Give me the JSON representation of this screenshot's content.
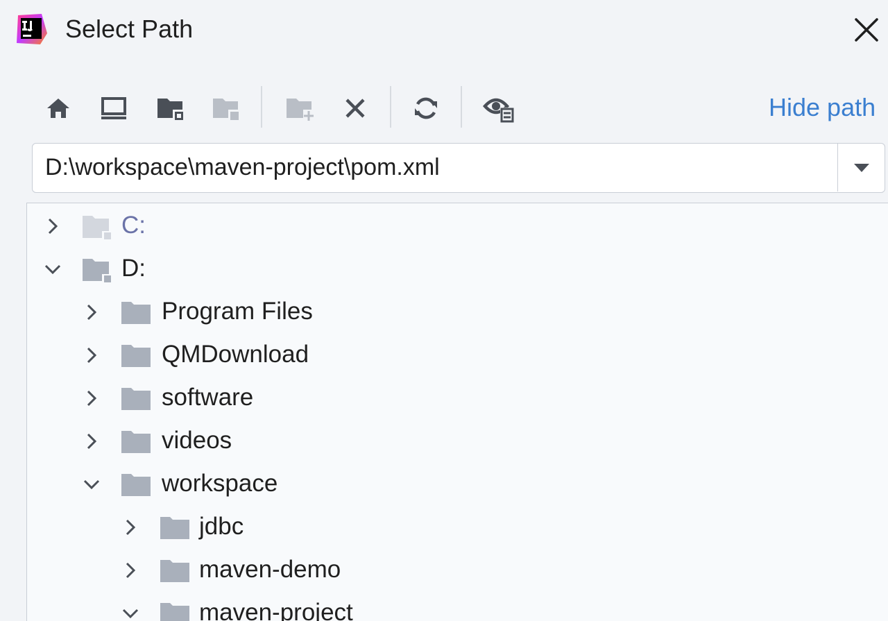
{
  "window": {
    "title": "Select Path",
    "app_icon": "intellij-idea-icon",
    "close_icon": "close-icon"
  },
  "toolbar": {
    "buttons": [
      {
        "name": "home-button",
        "icon": "home-icon",
        "enabled": true
      },
      {
        "name": "desktop-button",
        "icon": "desktop-icon",
        "enabled": true
      },
      {
        "name": "project-folder-button",
        "icon": "project-folder-icon",
        "enabled": true
      },
      {
        "name": "module-folder-button",
        "icon": "module-folder-icon",
        "enabled": false
      },
      {
        "name": "new-folder-button",
        "icon": "new-folder-icon",
        "enabled": false
      },
      {
        "name": "delete-button",
        "icon": "delete-x-icon",
        "enabled": true
      },
      {
        "name": "refresh-button",
        "icon": "refresh-icon",
        "enabled": true
      },
      {
        "name": "show-hidden-button",
        "icon": "show-hidden-files-icon",
        "enabled": true
      }
    ],
    "hide_path_label": "Hide path"
  },
  "path_field": {
    "value": "D:\\workspace\\maven-project\\pom.xml",
    "dropdown_icon": "triangle-down-icon"
  },
  "tree": {
    "items": [
      {
        "label": "C:",
        "depth": 0,
        "expanded": false,
        "kind": "drive",
        "dimmed": true
      },
      {
        "label": "D:",
        "depth": 0,
        "expanded": true,
        "kind": "drive",
        "dimmed": false
      },
      {
        "label": "Program Files",
        "depth": 1,
        "expanded": false,
        "kind": "folder"
      },
      {
        "label": "QMDownload",
        "depth": 1,
        "expanded": false,
        "kind": "folder"
      },
      {
        "label": "software",
        "depth": 1,
        "expanded": false,
        "kind": "folder"
      },
      {
        "label": "videos",
        "depth": 1,
        "expanded": false,
        "kind": "folder"
      },
      {
        "label": "workspace",
        "depth": 1,
        "expanded": true,
        "kind": "folder"
      },
      {
        "label": "jdbc",
        "depth": 2,
        "expanded": false,
        "kind": "folder"
      },
      {
        "label": "maven-demo",
        "depth": 2,
        "expanded": false,
        "kind": "folder"
      },
      {
        "label": "maven-project",
        "depth": 2,
        "expanded": true,
        "kind": "folder"
      }
    ]
  },
  "colors": {
    "accent_link": "#3b7fd0",
    "folder": "#a9b0bb",
    "folder_dimmed": "#d3d7de",
    "drive_label_dimmed": "#6b73a8",
    "icon_dark": "#4a4f57",
    "icon_disabled": "#b9bec6"
  }
}
